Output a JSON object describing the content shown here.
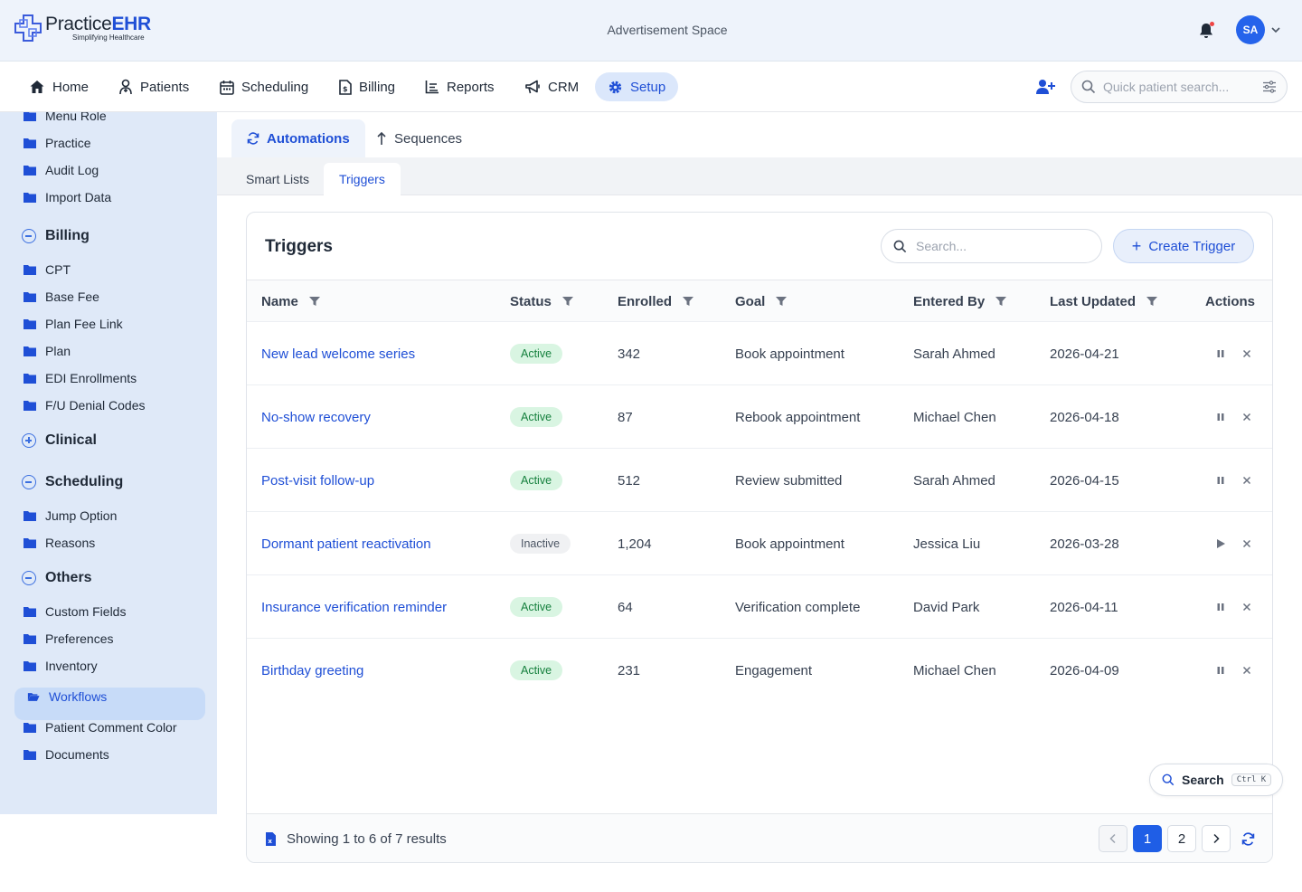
{
  "header": {
    "brand_prefix": "Practice",
    "brand_suffix": "EHR",
    "tagline": "Simplifying Healthcare",
    "ad_text": "Advertisement Space",
    "user_initials": "SA"
  },
  "nav": {
    "items": [
      {
        "label": "Home",
        "icon": "home-icon"
      },
      {
        "label": "Patients",
        "icon": "patients-icon"
      },
      {
        "label": "Scheduling",
        "icon": "calendar-icon"
      },
      {
        "label": "Billing",
        "icon": "billing-icon"
      },
      {
        "label": "Reports",
        "icon": "reports-icon"
      },
      {
        "label": "CRM",
        "icon": "megaphone-icon"
      },
      {
        "label": "Setup",
        "icon": "gear-icon",
        "active": true
      }
    ],
    "quick_search_placeholder": "Quick patient search..."
  },
  "sidebar": {
    "top_items": [
      "Menu Role",
      "Practice",
      "Audit Log",
      "Import Data"
    ],
    "groups": [
      {
        "label": "Billing",
        "expanded": true,
        "items": [
          "CPT",
          "Base Fee",
          "Plan Fee Link",
          "Plan",
          "EDI Enrollments",
          "F/U Denial Codes"
        ]
      },
      {
        "label": "Clinical",
        "expanded": false,
        "items": []
      },
      {
        "label": "Scheduling",
        "expanded": true,
        "items": [
          "Jump Option",
          "Reasons"
        ]
      },
      {
        "label": "Others",
        "expanded": true,
        "items": [
          "Custom Fields",
          "Preferences",
          "Inventory",
          "Workflows",
          "Patient Comment Color",
          "Documents"
        ]
      }
    ],
    "active_item": "Workflows"
  },
  "tabs": {
    "main": [
      {
        "label": "Automations",
        "active": true
      },
      {
        "label": "Sequences",
        "active": false
      }
    ],
    "sub": [
      {
        "label": "Smart Lists",
        "active": false
      },
      {
        "label": "Triggers",
        "active": true
      }
    ]
  },
  "card": {
    "title": "Triggers",
    "search_placeholder": "Search...",
    "create_label": "Create Trigger",
    "columns": [
      "Name",
      "Status",
      "Enrolled",
      "Goal",
      "Entered By",
      "Last Updated",
      "Actions"
    ],
    "rows": [
      {
        "name": "New lead welcome series",
        "status": "Active",
        "enrolled": "342",
        "goal": "Book appointment",
        "entered_by": "Sarah Ahmed",
        "updated": "2026-04-21",
        "action": "pause"
      },
      {
        "name": "No-show recovery",
        "status": "Active",
        "enrolled": "87",
        "goal": "Rebook appointment",
        "entered_by": "Michael Chen",
        "updated": "2026-04-18",
        "action": "pause"
      },
      {
        "name": "Post-visit follow-up",
        "status": "Active",
        "enrolled": "512",
        "goal": "Review submitted",
        "entered_by": "Sarah Ahmed",
        "updated": "2026-04-15",
        "action": "pause"
      },
      {
        "name": "Dormant patient reactivation",
        "status": "Inactive",
        "enrolled": "1,204",
        "goal": "Book appointment",
        "entered_by": "Jessica Liu",
        "updated": "2026-03-28",
        "action": "play"
      },
      {
        "name": "Insurance verification reminder",
        "status": "Active",
        "enrolled": "64",
        "goal": "Verification complete",
        "entered_by": "David Park",
        "updated": "2026-04-11",
        "action": "pause"
      },
      {
        "name": "Birthday greeting",
        "status": "Active",
        "enrolled": "231",
        "goal": "Engagement",
        "entered_by": "Michael Chen",
        "updated": "2026-04-09",
        "action": "pause"
      }
    ],
    "footer_text": "Showing 1 to 6 of 7 results",
    "pages": [
      "1",
      "2"
    ],
    "current_page": "1"
  },
  "floating_search": {
    "label": "Search",
    "shortcut": "Ctrl K"
  },
  "colors": {
    "accent": "#1f4fd6",
    "active_badge_bg": "#d9f5e2",
    "sidebar_bg": "#dfe9f8"
  }
}
